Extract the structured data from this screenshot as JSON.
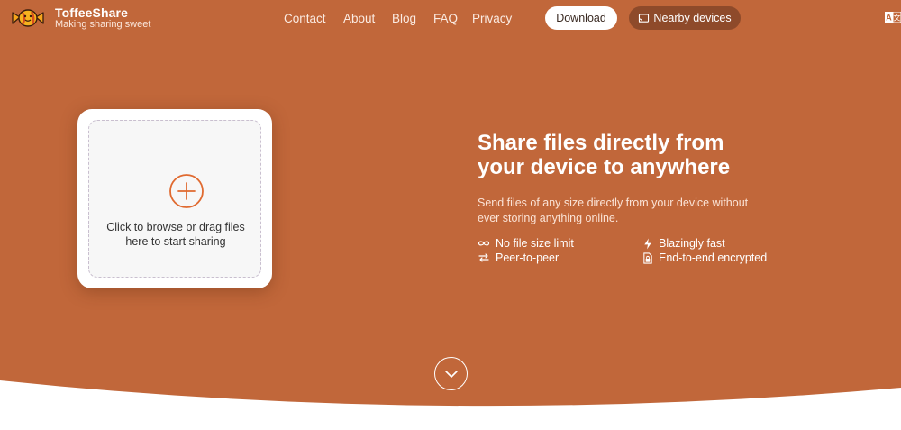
{
  "brand": {
    "name": "ToffeeShare",
    "tagline": "Making sharing sweet",
    "logo_icon": "candy-logo-icon"
  },
  "nav": {
    "contact": "Contact",
    "about": "About",
    "blog": "Blog",
    "faq": "FAQ",
    "privacy": "Privacy"
  },
  "header_buttons": {
    "download": "Download",
    "nearby": "Nearby devices",
    "nearby_icon": "cast-icon"
  },
  "upload": {
    "line1": "Click to browse or drag files",
    "line2": "here to start sharing",
    "icon": "plus-circle-icon"
  },
  "hero": {
    "headline_line1": "Share files directly from",
    "headline_line2": "your device to anywhere",
    "subtext_line1": "Send files of any size directly from your device without",
    "subtext_line2": "ever storing anything online."
  },
  "features": [
    {
      "label": "No file size limit",
      "icon": "infinity-icon"
    },
    {
      "label": "Peer-to-peer",
      "icon": "swap-arrows-icon"
    },
    {
      "label": "Blazingly fast",
      "icon": "lightning-icon"
    },
    {
      "label": "End-to-end encrypted",
      "icon": "locked-file-icon"
    }
  ],
  "colors": {
    "background": "#c1673a",
    "nearby_button": "#8e4a2a",
    "accent": "#e06a30"
  }
}
